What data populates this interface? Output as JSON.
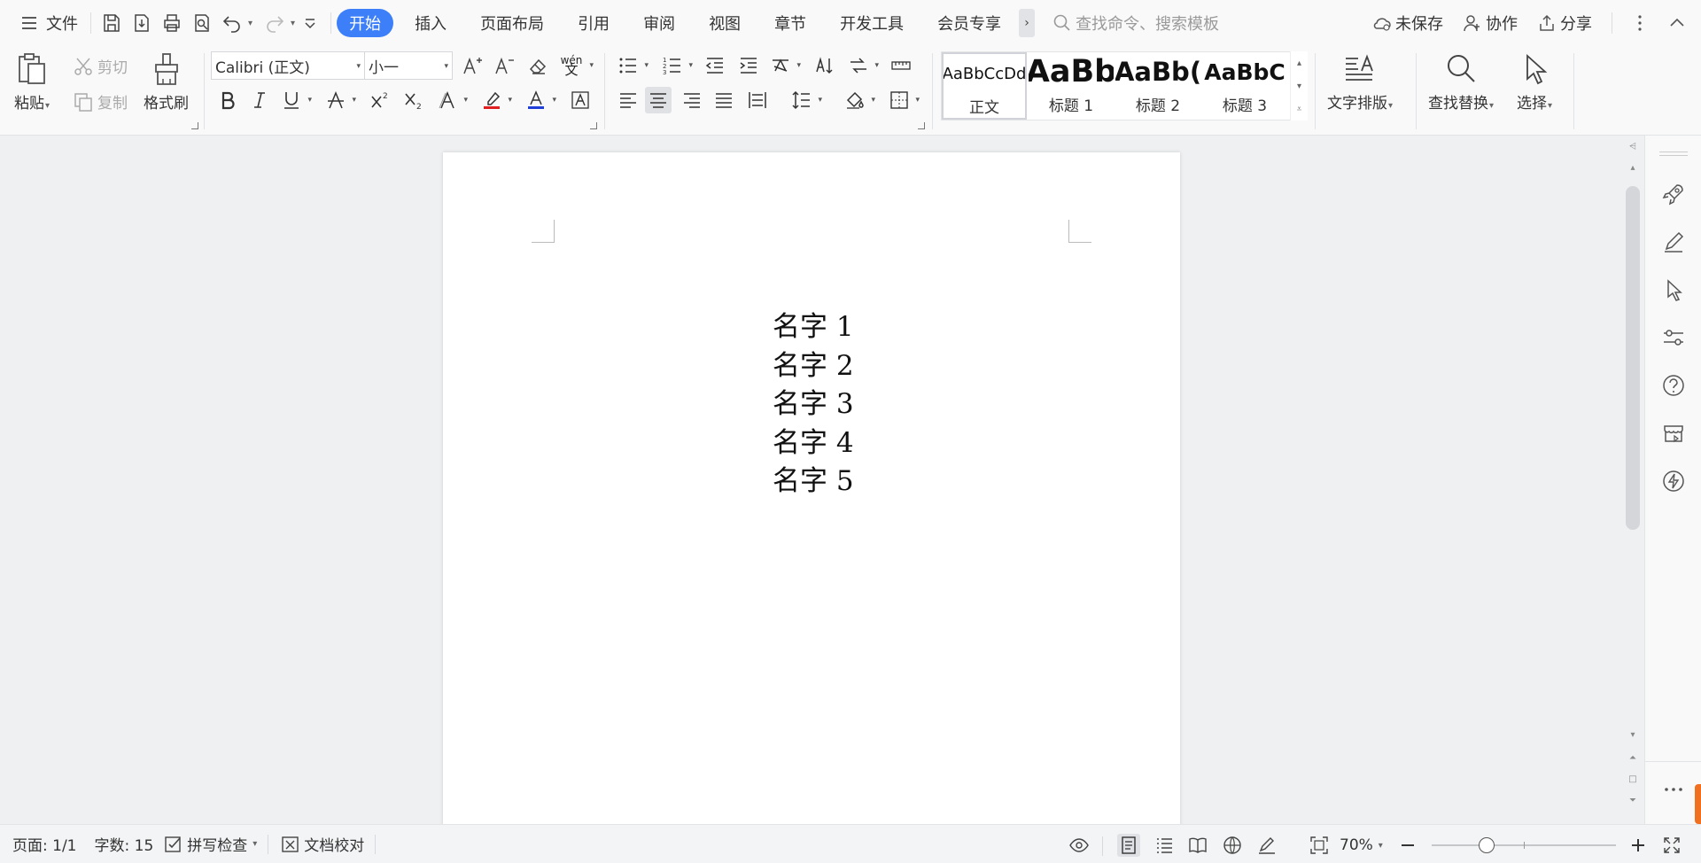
{
  "menubar": {
    "file_label": "文件",
    "tabs": [
      {
        "label": "开始",
        "active": true
      },
      {
        "label": "插入",
        "active": false
      },
      {
        "label": "页面布局",
        "active": false
      },
      {
        "label": "引用",
        "active": false
      },
      {
        "label": "审阅",
        "active": false
      },
      {
        "label": "视图",
        "active": false
      },
      {
        "label": "章节",
        "active": false
      },
      {
        "label": "开发工具",
        "active": false
      },
      {
        "label": "会员专享",
        "active": false
      }
    ],
    "more_tabs_glyph": "›",
    "search_placeholder": "查找命令、搜索模板",
    "unsaved_label": "未保存",
    "collab_label": "协作",
    "share_label": "分享"
  },
  "ribbon": {
    "clipboard": {
      "paste_label": "粘贴",
      "cut_label": "剪切",
      "copy_label": "复制",
      "format_painter_label": "格式刷"
    },
    "font": {
      "font_name": "Calibri (正文)",
      "font_size": "小一",
      "phonetic_glyph": "wén"
    },
    "styles": [
      {
        "preview": "AaBbCcDd",
        "name": "正文",
        "selected": true
      },
      {
        "preview": "AaBb",
        "name": "标题 1",
        "selected": false
      },
      {
        "preview": "AaBb(",
        "name": "标题 2",
        "selected": false
      },
      {
        "preview": "AaBbC",
        "name": "标题 3",
        "selected": false
      }
    ],
    "text_layout_label": "文字排版",
    "find_replace_label": "查找替换",
    "select_label": "选择"
  },
  "document": {
    "lines": [
      "名字 1",
      "名字 2",
      "名字 3",
      "名字 4",
      "名字 5"
    ]
  },
  "statusbar": {
    "page_info": "页面: 1/1",
    "word_count": "字数: 15",
    "spell_check_label": "拼写检查",
    "doc_proof_label": "文档校对",
    "zoom_level": "70%",
    "zoom_fraction": 0.3
  },
  "colors": {
    "accent": "#3d7ff8",
    "highlight_bar": "#e02020",
    "font_color_bar": "#1f3fd8"
  },
  "icons": {
    "menu": "hamburger-icon",
    "save": "save-icon",
    "more": "more-vertical-icon",
    "collapse": "chevron-up-icon"
  }
}
